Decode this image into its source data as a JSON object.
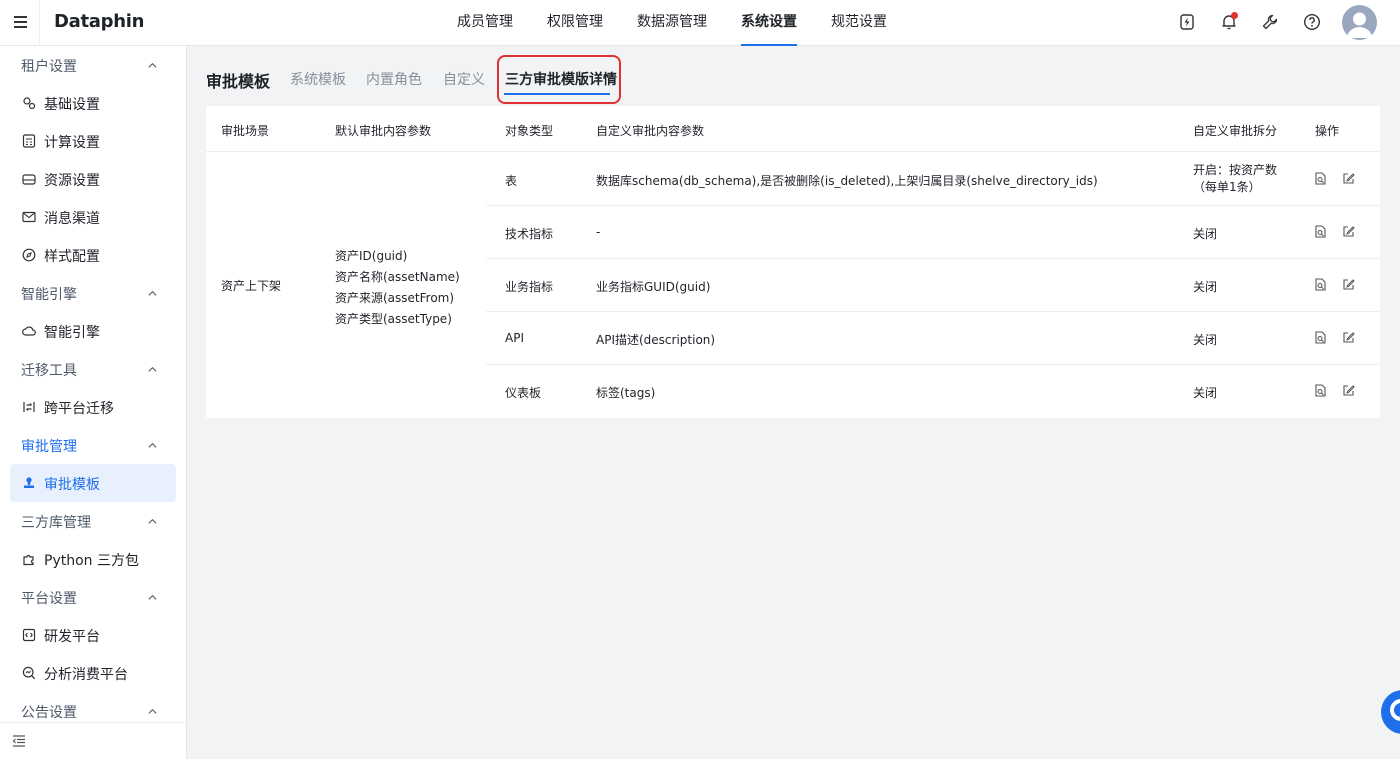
{
  "brand": {
    "logo": "Dataphin"
  },
  "nav": {
    "items": [
      {
        "label": "成员管理"
      },
      {
        "label": "权限管理"
      },
      {
        "label": "数据源管理"
      },
      {
        "label": "系统设置"
      },
      {
        "label": "规范设置"
      }
    ],
    "active": "系统设置"
  },
  "toolbar": {
    "icons": [
      "lightning-icon",
      "bell-icon",
      "wrench-icon",
      "help-icon",
      "avatar"
    ]
  },
  "sidebar": {
    "groups": [
      {
        "title": "租户设置",
        "items": [
          "基础设置",
          "计算设置",
          "资源设置",
          "消息渠道",
          "样式配置"
        ]
      },
      {
        "title": "智能引擎",
        "items": [
          "智能引擎"
        ]
      },
      {
        "title": "迁移工具",
        "items": [
          "跨平台迁移"
        ]
      },
      {
        "title": "审批管理",
        "items": [
          "审批模板"
        ]
      },
      {
        "title": "三方库管理",
        "items": [
          "Python 三方包"
        ]
      },
      {
        "title": "平台设置",
        "items": [
          "研发平台",
          "分析消费平台"
        ]
      },
      {
        "title": "公告设置",
        "items": []
      }
    ],
    "active_item": "审批模板"
  },
  "page": {
    "title": "审批模板",
    "tabs": [
      "系统模板",
      "内置角色",
      "自定义",
      "三方审批模版详情"
    ],
    "active_tab": "三方审批模版详情"
  },
  "table": {
    "columns": [
      "审批场景",
      "默认审批内容参数",
      "对象类型",
      "自定义审批内容参数",
      "自定义审批拆分",
      "操作"
    ],
    "scene": "资产上下架",
    "default_params": [
      "资产ID(guid)",
      "资产名称(assetName)",
      "资产来源(assetFrom)",
      "资产类型(assetType)"
    ],
    "rows": [
      {
        "type": "表",
        "custom_params": "数据库schema(db_schema),是否被删除(is_deleted),上架归属目录(shelve_directory_ids)",
        "split": "开启：按资产数（每单1条）"
      },
      {
        "type": "技术指标",
        "custom_params": "-",
        "split": "关闭"
      },
      {
        "type": "业务指标",
        "custom_params": "业务指标GUID(guid)",
        "split": "关闭"
      },
      {
        "type": "API",
        "custom_params": "API描述(description)",
        "split": "关闭"
      },
      {
        "type": "仪表板",
        "custom_params": "标签(tags)",
        "split": "关闭"
      }
    ]
  },
  "colors": {
    "accent": "#1f6feb",
    "highlight": "#e03131",
    "active_bg": "#e8f0fe"
  }
}
